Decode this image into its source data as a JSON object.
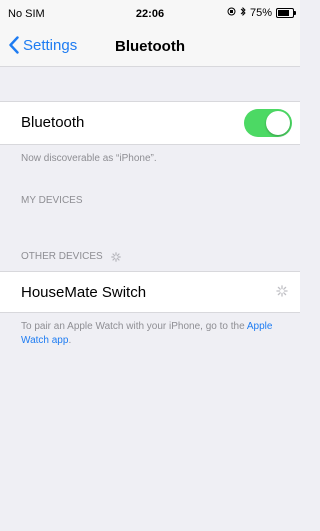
{
  "status": {
    "carrier": "No SIM",
    "time": "22:06",
    "battery_percent": "75%",
    "battery_level": 0.75
  },
  "nav": {
    "back_label": "Settings",
    "title": "Bluetooth"
  },
  "bluetooth": {
    "label": "Bluetooth",
    "enabled": true,
    "discoverable_text": "Now discoverable as “iPhone”."
  },
  "my_devices": {
    "header": "MY DEVICES"
  },
  "other_devices": {
    "header": "OTHER DEVICES",
    "items": [
      {
        "name": "HouseMate Switch"
      }
    ]
  },
  "hint": {
    "text": "To pair an Apple Watch with your iPhone, go to the ",
    "link_label": "Apple Watch app",
    "suffix": "."
  },
  "colors": {
    "accent": "#1e7cf2",
    "toggle_on": "#4cd964",
    "background": "#efeff4"
  }
}
